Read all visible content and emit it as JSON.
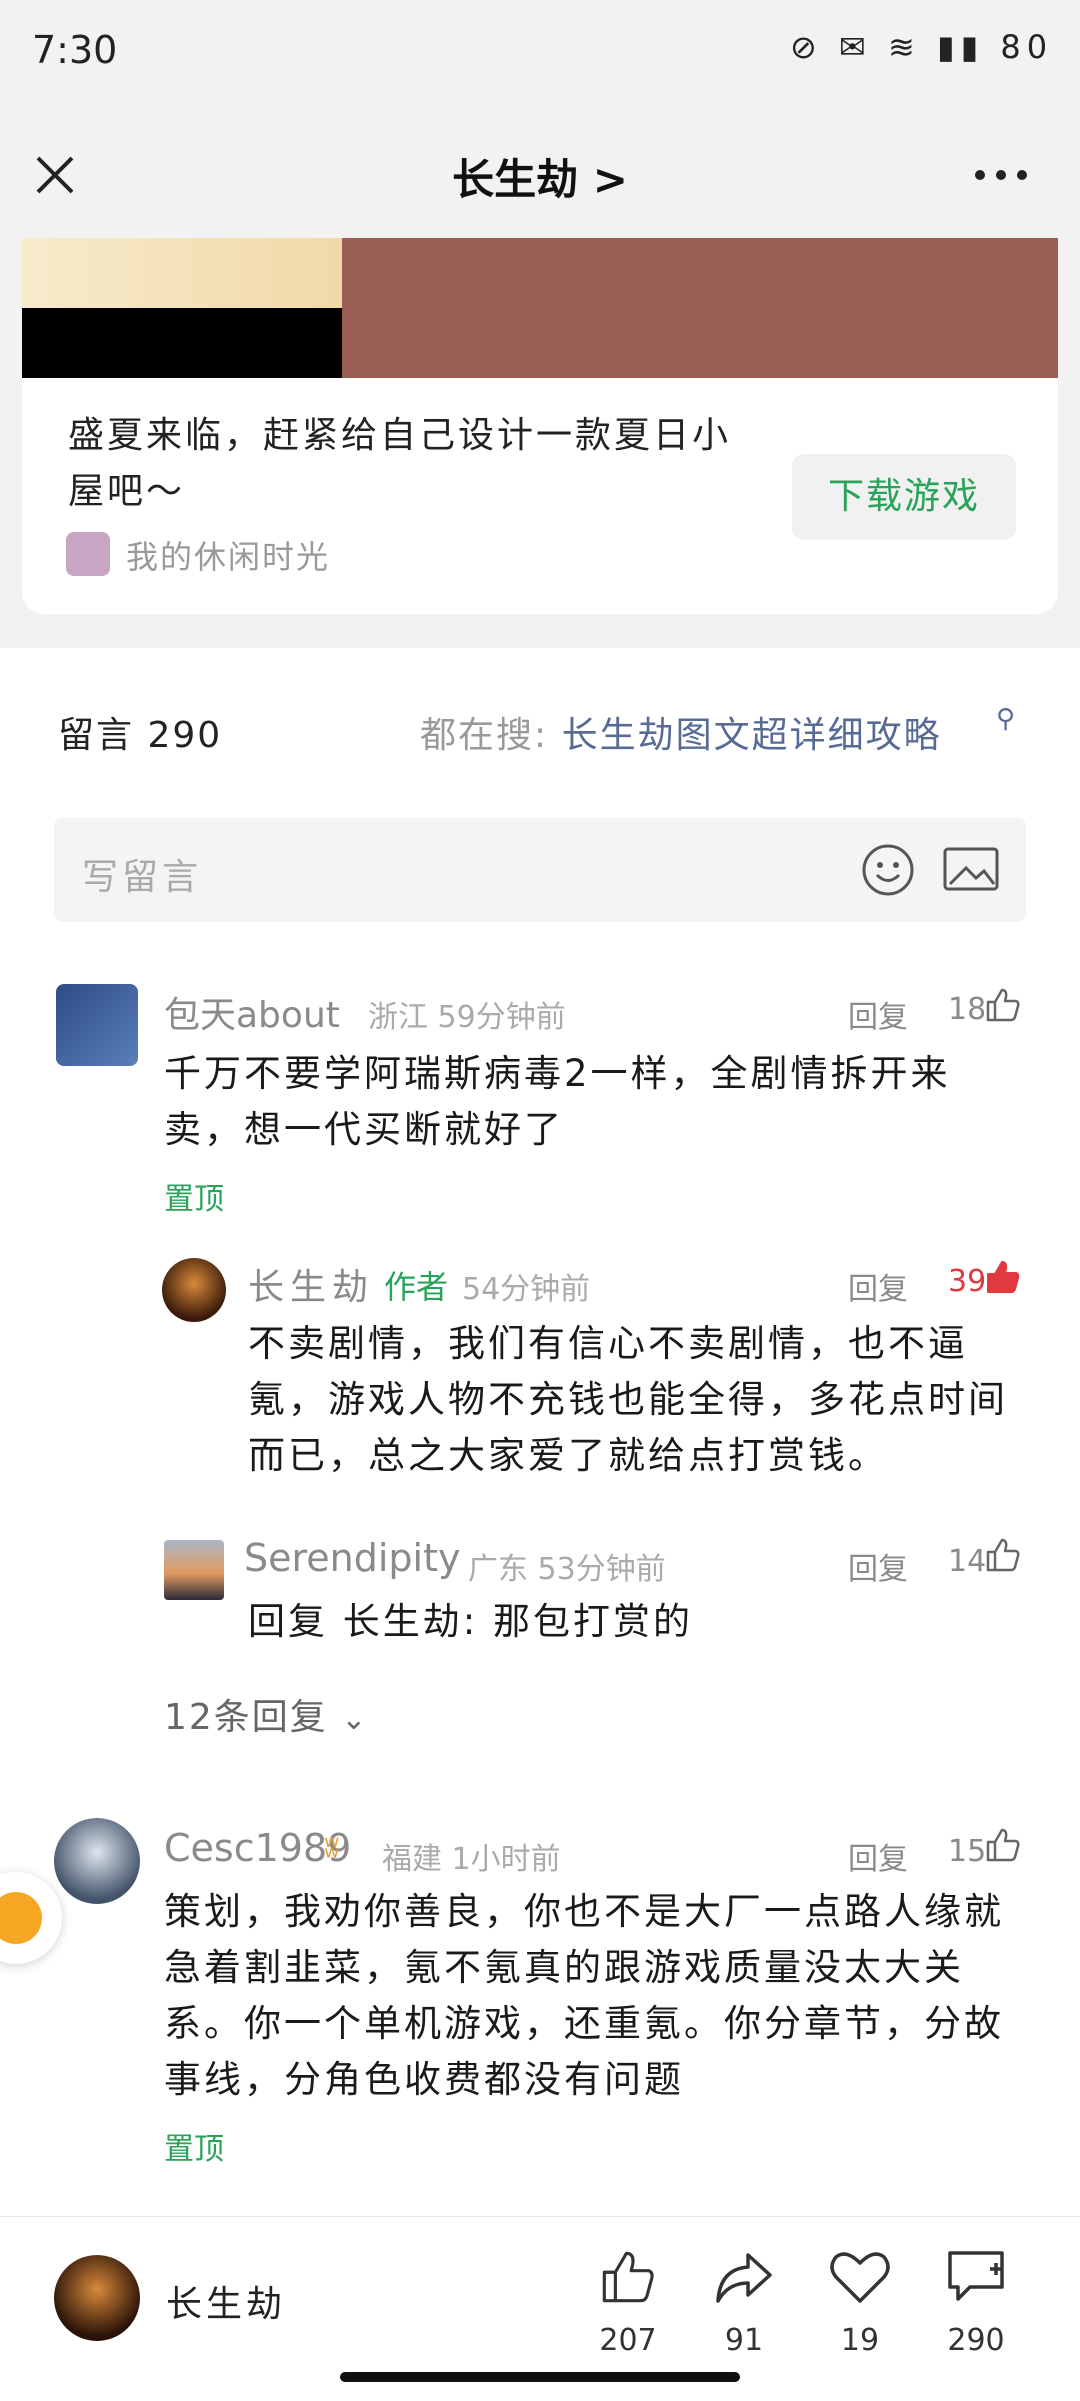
{
  "status": {
    "time": "7:30",
    "icons_text": "⊘ ✉ ≋ ▮▮ 80",
    "battery": "80"
  },
  "header": {
    "title": "长生劫 >",
    "close_icon": "close-icon",
    "more_icon": "more-icon"
  },
  "article_card": {
    "description": "盛夏来临，赶紧给自己设计一款夏日小屋吧～",
    "account": "我的休闲时光",
    "download_button": "下载游戏"
  },
  "comments_header": {
    "label": "留言 290",
    "search_prefix": "都在搜:",
    "search_term": "长生劫图文超详细攻略"
  },
  "write_box": {
    "placeholder": "写留言"
  },
  "comments": [
    {
      "name": "包天about",
      "meta": "浙江 59分钟前",
      "reply": "回复",
      "likes": "18",
      "text": "千万不要学阿瑞斯病毒2一样，全剧情拆开来卖，想一代买断就好了",
      "pin": "置顶",
      "replies": [
        {
          "name": "长生劫",
          "tag": "作者",
          "meta": "54分钟前",
          "reply": "回复",
          "likes": "39",
          "liked": true,
          "text": "不卖剧情，我们有信心不卖剧情，也不逼氪，游戏人物不充钱也能全得，多花点时间而已，总之大家爱了就给点打赏钱。"
        },
        {
          "name": "Serendipity",
          "meta": "广东 53分钟前",
          "reply": "回复",
          "likes": "14",
          "text": "回复 长生劫: 那包打赏的"
        }
      ],
      "more_replies": "12条回复"
    },
    {
      "name": "Cesc1989",
      "meta": "福建 1小时前",
      "reply": "回复",
      "likes": "15",
      "text": "策划，我劝你善良，你也不是大厂一点路人缘就急着割韭菜，氪不氪真的跟游戏质量没太大关系。你一个单机游戏，还重氪。你分章节，分故事线，分角色收费都没有问题",
      "pin": "置顶"
    }
  ],
  "bottom_bar": {
    "account_name": "长生劫",
    "like_count": "207",
    "share_count": "91",
    "favorite_count": "19",
    "comment_count": "290"
  },
  "colors": {
    "accent_green": "#2aa35a",
    "link_blue": "#576b95",
    "like_red": "#e0393e"
  }
}
